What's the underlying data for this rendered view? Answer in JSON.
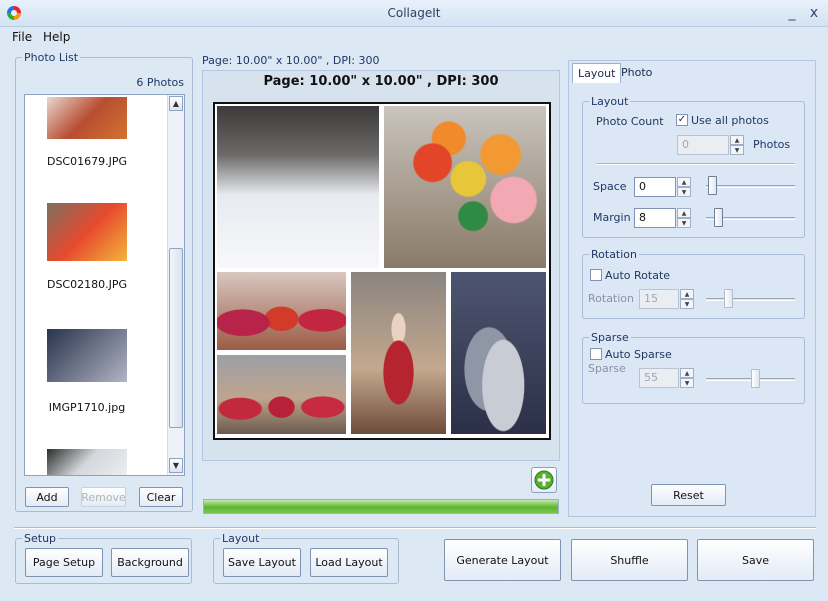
{
  "window": {
    "title": "CollageIt",
    "minimize_glyph": "_",
    "close_glyph": "x"
  },
  "menu": [
    "File",
    "Help"
  ],
  "photo_list": {
    "group_label": "Photo List",
    "count_text": "6 Photos",
    "items": [
      {
        "name": "DSC01679.JPG",
        "colors": [
          "#e8d8cf",
          "#b84d32",
          "#d2742f"
        ]
      },
      {
        "name": "DSC02180.JPG",
        "colors": [
          "#7b7060",
          "#e64a2e",
          "#f3b53a"
        ]
      },
      {
        "name": "IMGP1710.jpg",
        "colors": [
          "#29334d",
          "#6c7287",
          "#b0b6c3"
        ]
      },
      {
        "name": "",
        "colors": [
          "#2a2f2b",
          "#d4d7dc",
          "#ecedf0"
        ]
      }
    ],
    "buttons": {
      "add": "Add",
      "remove": "Remove",
      "clear": "Clear"
    }
  },
  "page_info": {
    "small_label": "Page:  10.00\" x 10.00\" , DPI: 300",
    "title": "Page:  10.00\" x 10.00\" , DPI: 300"
  },
  "collage_photos": [
    {
      "name": "snowy-road-photo",
      "bg": "linear-gradient(#3b3a38 0%,#6b6a68 30%,#e7eaef 55%,#f7f8fb 100%)"
    },
    {
      "name": "balloons-photo",
      "bg": "radial-gradient(circle at 30% 35%,#e24527 0 12%,transparent 13%),radial-gradient(circle at 52% 45%,#e7c63a 0 14%,transparent 15%),radial-gradient(circle at 72% 30%,#f29933 0 12%,transparent 13%),radial-gradient(circle at 80% 58%,#f3a9b3 0 14%,transparent 15%),radial-gradient(circle at 40% 20%,#f08a2a 0 10%,transparent 11%),radial-gradient(circle at 55% 68%,#2f8a43 0 10%,transparent 11%),linear-gradient(#c9c4bd,#8a7a68)"
    },
    {
      "name": "dancers-photo-1",
      "bg": "radial-gradient(ellipse at 20% 65%,#b8234a 0 18%,transparent 19%),radial-gradient(ellipse at 50% 60%,#d23b2a 0 18%,transparent 19%),radial-gradient(ellipse at 82% 62%,#c3263f 0 16%,transparent 17%),linear-gradient(#d9c7bf,#9b5c47)"
    },
    {
      "name": "dancer-solo-photo",
      "bg": "radial-gradient(ellipse at 50% 62%,#b62430 0 22%,transparent 23%),radial-gradient(ellipse at 50% 35%,#e9d2bf 0 10%,transparent 11%),linear-gradient(#8a8480,#c4a88e 60%,#6e4b3a)"
    },
    {
      "name": "knitted-photo",
      "bg": "radial-gradient(ellipse at 55% 70%,#c8ccd4 0 28%,transparent 29%),radial-gradient(ellipse at 40% 60%,#8f96a6 0 30%,transparent 31%),linear-gradient(#4e5570,#2b3047)"
    },
    {
      "name": "dancers-photo-2",
      "bg": "radial-gradient(ellipse at 18% 68%,#c2293c 0 14%,transparent 15%),radial-gradient(ellipse at 50% 66%,#b9213a 0 14%,transparent 15%),radial-gradient(ellipse at 82% 66%,#c72b44 0 14%,transparent 15%),linear-gradient(#9b9fa6,#bfa48c 55%,#6a5b4e)"
    }
  ],
  "progress": {
    "value_fraction": 1.0
  },
  "tabs": {
    "layout": "Layout",
    "photo": "Photo"
  },
  "layout_group": {
    "label": "Layout",
    "photo_count_label": "Photo Count",
    "use_all_label": "Use all photos",
    "use_all_checked": true,
    "photo_count_value": "0",
    "photos_unit": "Photos",
    "space_label": "Space",
    "space_value": "0",
    "space_slider_fraction": 0.0,
    "margin_label": "Margin",
    "margin_value": "8",
    "margin_slider_fraction": 0.08
  },
  "rotation_group": {
    "label": "Rotation",
    "auto_label": "Auto Rotate",
    "auto_checked": false,
    "value_label": "Rotation",
    "value": "15",
    "slider_fraction": 0.2
  },
  "sparse_group": {
    "label": "Sparse",
    "auto_label": "Auto Sparse",
    "auto_checked": false,
    "value_label": "Sparse",
    "value": "55",
    "slider_fraction": 0.55
  },
  "reset_label": "Reset",
  "setup_group": {
    "label": "Setup",
    "page_setup": "Page Setup",
    "background": "Background"
  },
  "layout_buttons_group": {
    "label": "Layout",
    "save_layout": "Save Layout",
    "load_layout": "Load Layout"
  },
  "actions": {
    "generate": "Generate Layout",
    "shuffle": "Shuffle",
    "save": "Save"
  },
  "colors": {
    "accent": "#5cb531",
    "window_bg": "#dde8f5",
    "border": "#a9bcd6"
  }
}
